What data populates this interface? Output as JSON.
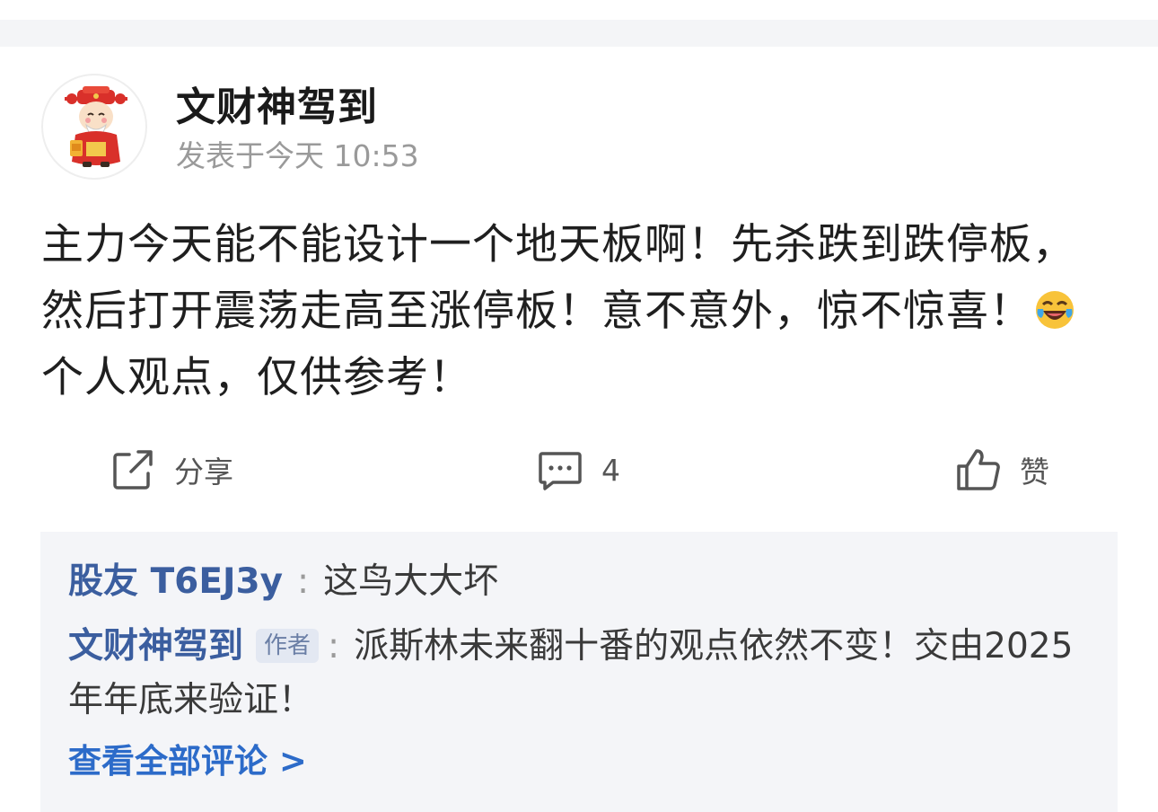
{
  "post": {
    "author": "文财神驾到",
    "time": "发表于今天 10:53",
    "content_part1": "主力今天能不能设计一个地天板啊！先杀跌到跌停板，然后打开震荡走高至涨停板！意不意外，惊不惊喜！",
    "content_part2": "个人观点，仅供参考！",
    "emoji": "laugh-cry-emoji"
  },
  "actions": {
    "share_label": "分享",
    "comment_count": "4",
    "like_label": "赞"
  },
  "comments": [
    {
      "user": "股友 T6EJ3y",
      "colon": ":",
      "text": "这鸟大大坏"
    },
    {
      "user": "文财神驾到",
      "badge": "作者",
      "colon": ":",
      "text": "派斯林未来翻十番的观点依然不变！交由2025年年底来验证！"
    }
  ],
  "view_all": "查看全部评论 >",
  "colors": {
    "accent_link": "#2c6bc9",
    "comment_user": "#3b5e9f",
    "comment_bg": "#f4f5f8",
    "meta_gray": "#9a9a9a"
  }
}
